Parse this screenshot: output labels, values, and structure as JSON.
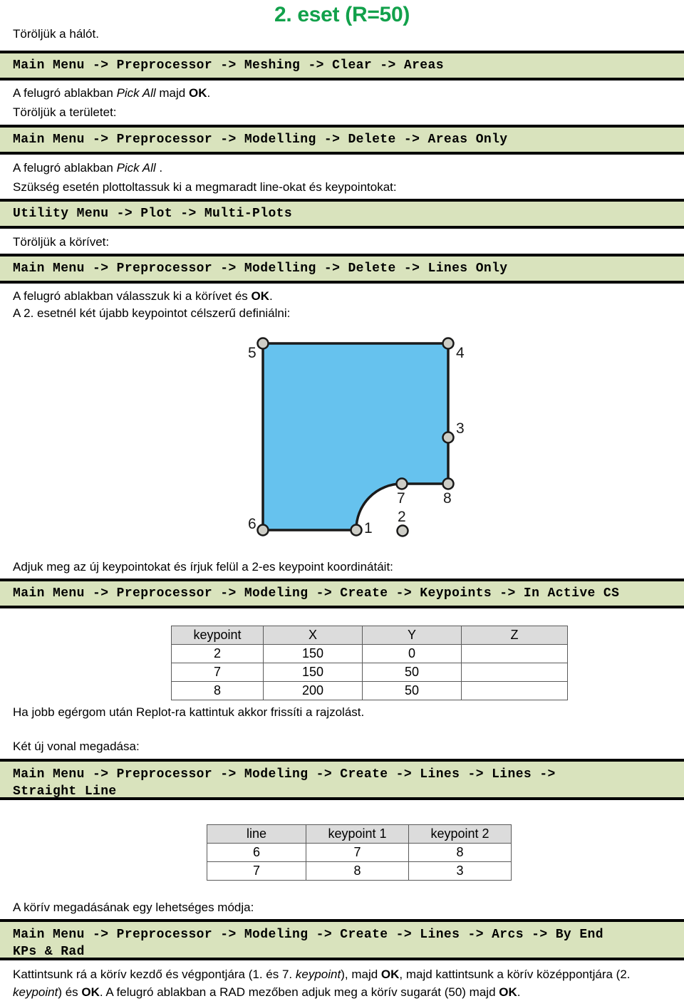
{
  "title": "2. eset (R=50)",
  "accent_color": "#12a14b",
  "cmdbox_color": "#d9e3bd",
  "blocks": {
    "t1": "Töröljük a hálót.",
    "c1": "Main Menu -> Preprocessor -> Meshing -> Clear -> Areas",
    "t2_a": "A felugró ablakban ",
    "t2_b": "Pick All",
    "t2_c": " majd ",
    "t2_d": "OK",
    "t2_e": ".",
    "t3": "Töröljük a területet:",
    "c2": "Main Menu -> Preprocessor -> Modelling -> Delete -> Areas Only",
    "t4_a": "A felugró ablakban ",
    "t4_b": "Pick All",
    "t4_c": " .",
    "t5": "Szükség esetén plottoltassuk ki a megmaradt line-okat és keypointokat:",
    "c3": "Utility Menu -> Plot -> Multi-Plots",
    "t6": "Töröljük a körívet:",
    "c4": "Main Menu -> Preprocessor -> Modelling -> Delete -> Lines Only",
    "t7_a": "A felugró ablakban válasszuk ki a körívet és ",
    "t7_b": "OK",
    "t7_c": ".",
    "t8": "A 2. esetnél két újabb keypointot célszerű definiálni:",
    "t9": "Adjuk meg az új keypointokat és írjuk felül a 2-es keypoint koordinátáit:",
    "c5": "Main Menu -> Preprocessor -> Modeling -> Create -> Keypoints -> In Active CS",
    "t10": "Ha jobb egérgom után Replot-ra kattintuk akkor frissíti a rajzolást.",
    "t11": "Két új vonal megadása:",
    "c6_line1": "Main Menu -> Preprocessor -> Modeling -> Create -> Lines -> Lines ->",
    "c6_line2": "Straight Line",
    "t12": "A körív megadásának egy lehetséges módja:",
    "c7_line1": "Main Menu -> Preprocessor -> Modeling -> Create -> Lines -> Arcs -> By End",
    "c7_line2": "KPs & Rad",
    "t13_a": "Kattintsunk rá a körív kezdő és végpontjára (1. és 7. ",
    "t13_b": "keypoint",
    "t13_c": "), majd ",
    "t13_d": "OK",
    "t13_e": ", majd kattintsunk a körív középpontjára (2. ",
    "t13_f": "keypoint",
    "t13_g": ") és ",
    "t13_h": "OK",
    "t13_i": ". A felugró ablakban a RAD mezőben adjuk meg a körív sugarát (50) majd ",
    "t13_j": "OK",
    "t13_k": "."
  },
  "keypoint_table": {
    "headers": [
      "keypoint",
      "X",
      "Y",
      "Z"
    ],
    "rows": [
      [
        "2",
        "150",
        "0",
        ""
      ],
      [
        "7",
        "150",
        "50",
        ""
      ],
      [
        "8",
        "200",
        "50",
        ""
      ]
    ]
  },
  "line_table": {
    "headers": [
      "line",
      "keypoint 1",
      "keypoint 2"
    ],
    "rows": [
      [
        "6",
        "7",
        "8"
      ],
      [
        "7",
        "8",
        "3"
      ]
    ]
  },
  "figure": {
    "fill_color": "#66c2ee",
    "stroke_color": "#1a1a1a",
    "keypoint_fill": "#cdcdc6",
    "labels": [
      "1",
      "2",
      "3",
      "4",
      "5",
      "6",
      "7",
      "8"
    ]
  }
}
